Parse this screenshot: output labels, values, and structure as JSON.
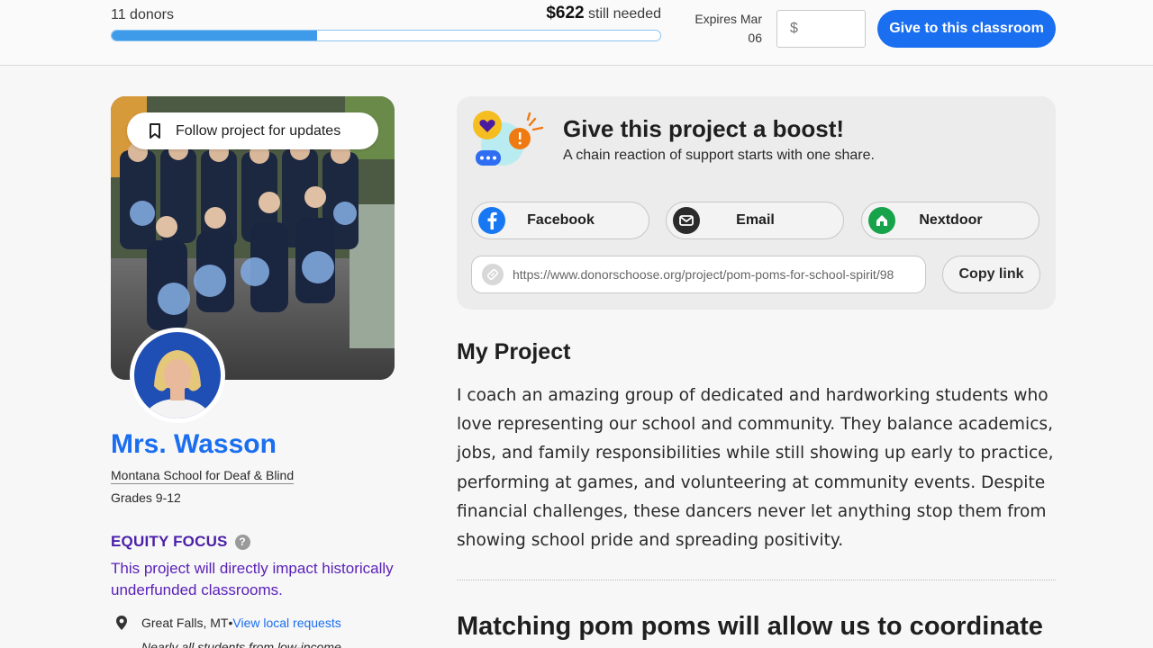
{
  "topbar": {
    "donors": "11 donors",
    "needed_amount": "$622",
    "needed_suffix": " still needed",
    "progress_fraction": 0.375,
    "expires": "Expires Mar 06",
    "amount_placeholder": "$",
    "give_label": "Give to this classroom"
  },
  "photo": {
    "follow_label": "Follow project for updates"
  },
  "teacher": {
    "name": "Mrs. Wasson",
    "school": "Montana School for Deaf & Blind",
    "grades": "Grades 9-12"
  },
  "equity": {
    "title": "EQUITY FOCUS",
    "help_glyph": "?",
    "text": "This project will directly impact historically underfunded classrooms."
  },
  "location": {
    "city": "Great Falls, MT",
    "separator": " • ",
    "link": "View local requests",
    "poverty": "Nearly all students from low-income"
  },
  "share": {
    "title": "Give this project a boost!",
    "subtitle": "A chain reaction of support starts with one share.",
    "facebook": "Facebook",
    "email": "Email",
    "nextdoor": "Nextdoor",
    "url": "https://www.donorschoose.org/project/pom-poms-for-school-spirit/98",
    "copy_label": "Copy link",
    "colors": {
      "facebook": "#1877f2",
      "email": "#2b2b2b",
      "nextdoor": "#17a34a"
    }
  },
  "project": {
    "heading": "My Project",
    "description": "I coach an amazing group of dedicated and hardworking students who love representing our school and community. They balance academics, jobs, and family responsibilities while still showing up early to practice, performing at games, and volunteering at community events. Despite financial challenges, these dancers never let anything stop them from showing school pride and spreading positivity.",
    "subheading": "Matching pom poms will allow us to coordinate"
  },
  "colors": {
    "accent": "#1a6ef0",
    "equity": "#4b1fa8",
    "progress": "#3d9be9"
  },
  "icons": [
    "bookmark-icon",
    "location-pin-icon",
    "help-icon",
    "facebook-icon",
    "email-icon",
    "nextdoor-icon",
    "link-icon",
    "boost-illustration-icon"
  ]
}
